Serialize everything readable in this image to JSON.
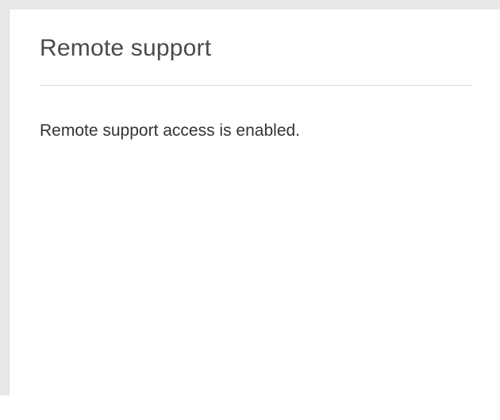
{
  "card": {
    "title": "Remote support",
    "message": "Remote support access is enabled."
  },
  "colors": {
    "background": "#e8e8e8",
    "card": "#ffffff",
    "title_text": "#4a4a4a",
    "body_text": "#333333",
    "divider": "#dcdcdc"
  }
}
